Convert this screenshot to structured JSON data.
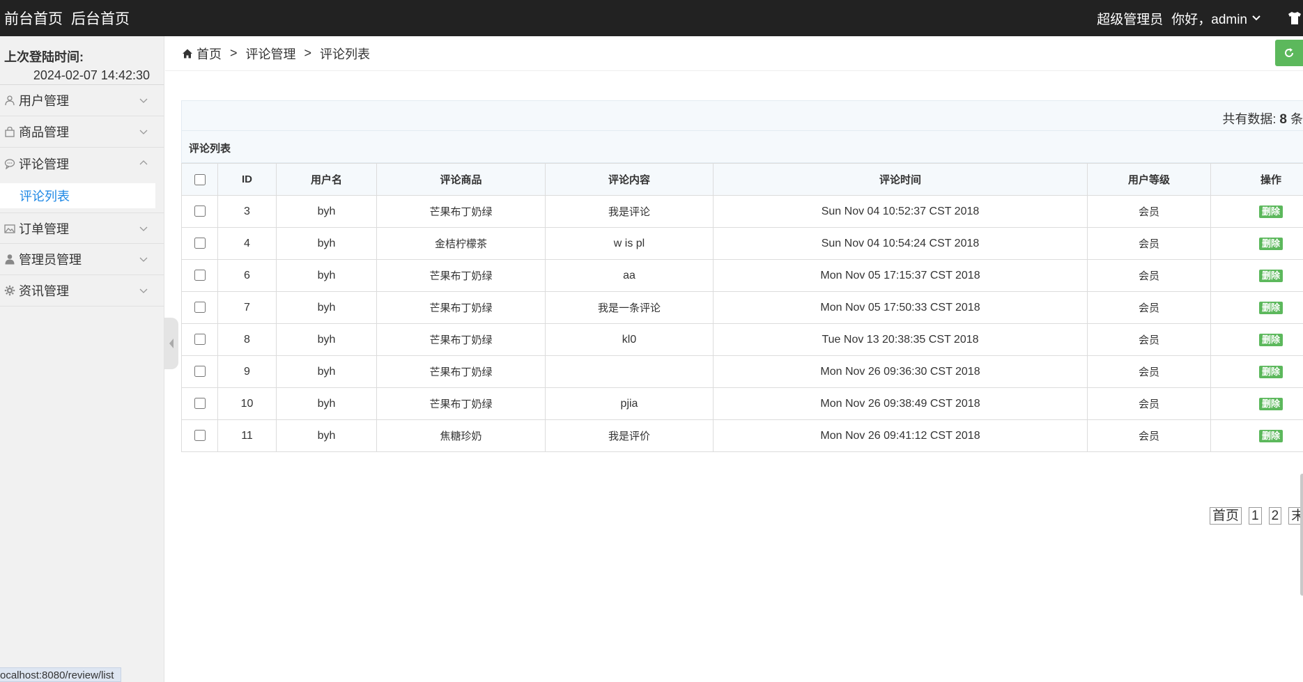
{
  "topbar": {
    "nav": [
      "前台首页",
      "后台首页"
    ],
    "role": "超级管理员",
    "greeting": "你好，admin"
  },
  "sidebar": {
    "login_label": "上次登陆时间:",
    "login_time": "2024-02-07 14:42:30",
    "menu": [
      {
        "label": "用户管理",
        "icon": "user-icon"
      },
      {
        "label": "商品管理",
        "icon": "bag-icon"
      },
      {
        "label": "评论管理",
        "icon": "comment-icon",
        "expanded": true
      },
      {
        "label": "订单管理",
        "icon": "image-icon"
      },
      {
        "label": "管理员管理",
        "icon": "admin-icon"
      },
      {
        "label": "资讯管理",
        "icon": "gear-icon"
      }
    ],
    "submenu_active": "评论列表",
    "status_url": "ocalhost:8080/review/list"
  },
  "breadcrumb": {
    "home": "首页",
    "sep": ">",
    "level1": "评论管理",
    "level2": "评论列表"
  },
  "summary": {
    "label": "共有数据:",
    "count": "8",
    "unit": "条"
  },
  "panel_title": "评论列表",
  "table": {
    "headers": [
      "ID",
      "用户名",
      "评论商品",
      "评论内容",
      "评论时间",
      "用户等级",
      "操作"
    ],
    "delete_label": "删除",
    "rows": [
      {
        "id": "3",
        "user": "byh",
        "product": "芒果布丁奶绿",
        "content": "我是评论",
        "time": "Sun Nov 04 10:52:37 CST 2018",
        "level": "会员"
      },
      {
        "id": "4",
        "user": "byh",
        "product": "金桔柠檬茶",
        "content": "w is pl",
        "time": "Sun Nov 04 10:54:24 CST 2018",
        "level": "会员"
      },
      {
        "id": "6",
        "user": "byh",
        "product": "芒果布丁奶绿",
        "content": "aa",
        "time": "Mon Nov 05 17:15:37 CST 2018",
        "level": "会员"
      },
      {
        "id": "7",
        "user": "byh",
        "product": "芒果布丁奶绿",
        "content": "我是一条评论",
        "time": "Mon Nov 05 17:50:33 CST 2018",
        "level": "会员"
      },
      {
        "id": "8",
        "user": "byh",
        "product": "芒果布丁奶绿",
        "content": "kl0",
        "time": "Tue Nov 13 20:38:35 CST 2018",
        "level": "会员"
      },
      {
        "id": "9",
        "user": "byh",
        "product": "芒果布丁奶绿",
        "content": "",
        "time": "Mon Nov 26 09:36:30 CST 2018",
        "level": "会员"
      },
      {
        "id": "10",
        "user": "byh",
        "product": "芒果布丁奶绿",
        "content": "pjia",
        "time": "Mon Nov 26 09:38:49 CST 2018",
        "level": "会员"
      },
      {
        "id": "11",
        "user": "byh",
        "product": "焦糖珍奶",
        "content": "我是评价",
        "time": "Mon Nov 26 09:41:12 CST 2018",
        "level": "会员"
      }
    ]
  },
  "pager": [
    "首页",
    "1",
    "2",
    "末页"
  ],
  "colors": {
    "topbar": "#222222",
    "accent_green": "#5cb85c",
    "active_link": "#1e88e5"
  }
}
